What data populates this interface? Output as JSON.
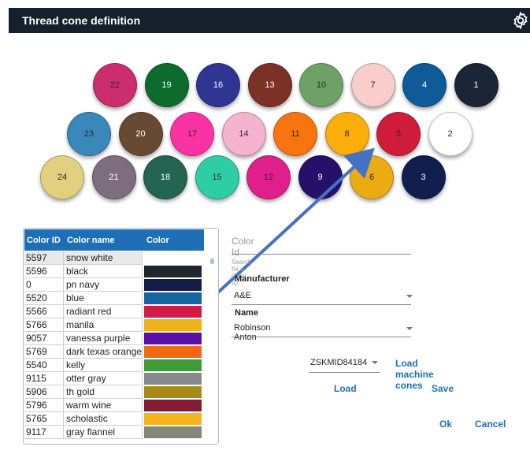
{
  "window": {
    "title": "Thread cone definition",
    "icon": "gear-icon"
  },
  "cones": [
    {
      "label": "22",
      "color": "#cb2d6f",
      "text": "#2a2a2a"
    },
    {
      "label": "19",
      "color": "#0c6b2d",
      "text": "#ffffff"
    },
    {
      "label": "16",
      "color": "#2f3592",
      "text": "#ffffff"
    },
    {
      "label": "13",
      "color": "#7c3127",
      "text": "#ffffff"
    },
    {
      "label": "10",
      "color": "#6ea166",
      "text": "#2a2a2a"
    },
    {
      "label": "7",
      "color": "#f8cdcb",
      "text": "#2a2a2a"
    },
    {
      "label": "4",
      "color": "#0f5b97",
      "text": "#ffffff"
    },
    {
      "label": "1",
      "color": "#1b2536",
      "text": "#ffffff"
    },
    {
      "label": "23",
      "color": "#3a87bb",
      "text": "#2a2a2a"
    },
    {
      "label": "20",
      "color": "#684a32",
      "text": "#ffffff"
    },
    {
      "label": "17",
      "color": "#fb32a4",
      "text": "#2a2a2a"
    },
    {
      "label": "14",
      "color": "#f6b3cf",
      "text": "#2a2a2a"
    },
    {
      "label": "11",
      "color": "#f7740e",
      "text": "#2a2a2a"
    },
    {
      "label": "8",
      "color": "#fbae0a",
      "text": "#2a2a2a"
    },
    {
      "label": "5",
      "color": "#cf1c3b",
      "text": "#2a2a2a"
    },
    {
      "label": "2",
      "color": "#ffffff",
      "text": "#2a2a2a"
    },
    {
      "label": "24",
      "color": "#e2d080",
      "text": "#2a2a2a"
    },
    {
      "label": "21",
      "color": "#7e6d7f",
      "text": "#ffffff"
    },
    {
      "label": "18",
      "color": "#236552",
      "text": "#ffffff"
    },
    {
      "label": "15",
      "color": "#2fcda5",
      "text": "#2a2a2a"
    },
    {
      "label": "12",
      "color": "#e01e8c",
      "text": "#2a2a2a"
    },
    {
      "label": "9",
      "color": "#25116a",
      "text": "#ffffff"
    },
    {
      "label": "6",
      "color": "#eaac12",
      "text": "#2a2a2a"
    },
    {
      "label": "3",
      "color": "#111f4e",
      "text": "#ffffff"
    }
  ],
  "color_table": {
    "headers": {
      "id": "Color ID",
      "name": "Color name",
      "color": "Color"
    },
    "rows": [
      {
        "id": "5597",
        "name": "snow white",
        "swatch": "#ffffff",
        "selected": true
      },
      {
        "id": "5596",
        "name": "black",
        "swatch": "#1e2530"
      },
      {
        "id": "0",
        "name": "pn navy",
        "swatch": "#121d4a"
      },
      {
        "id": "5520",
        "name": "blue",
        "swatch": "#1665a3"
      },
      {
        "id": "5566",
        "name": "radiant red",
        "swatch": "#d31b43"
      },
      {
        "id": "5766",
        "name": "manila",
        "swatch": "#efb31a"
      },
      {
        "id": "9057",
        "name": "vanessa purple",
        "swatch": "#5a0ea5"
      },
      {
        "id": "5769",
        "name": "dark texas orange",
        "swatch": "#f06a14"
      },
      {
        "id": "5540",
        "name": "kelly",
        "swatch": "#3f9a37"
      },
      {
        "id": "9115",
        "name": "otter gray",
        "swatch": "#858a8a"
      },
      {
        "id": "5906",
        "name": "th gold",
        "swatch": "#a88a17"
      },
      {
        "id": "5796",
        "name": "warm wine",
        "swatch": "#7f1e35"
      },
      {
        "id": "5765",
        "name": "scholastic",
        "swatch": "#f5b41e"
      },
      {
        "id": "9117",
        "name": "gray flannel",
        "swatch": "#85857a"
      }
    ]
  },
  "form": {
    "color_id": {
      "placeholder": "Color Id",
      "hint": "Search for a Color ID",
      "value": ""
    },
    "manufacturer": {
      "label": "Manufacturer",
      "value": "A&E"
    },
    "name": {
      "label": "Name",
      "value": "Robinson Anton"
    },
    "machine": {
      "value": "ZSKMID84184"
    },
    "buttons": {
      "load_machine_cones": "Load machine cones",
      "load": "Load",
      "save": "Save",
      "ok": "Ok",
      "cancel": "Cancel"
    }
  },
  "colors": {
    "header_bg": "#14202c",
    "accent": "#1e6fb8",
    "arrow": "#4472c4"
  }
}
